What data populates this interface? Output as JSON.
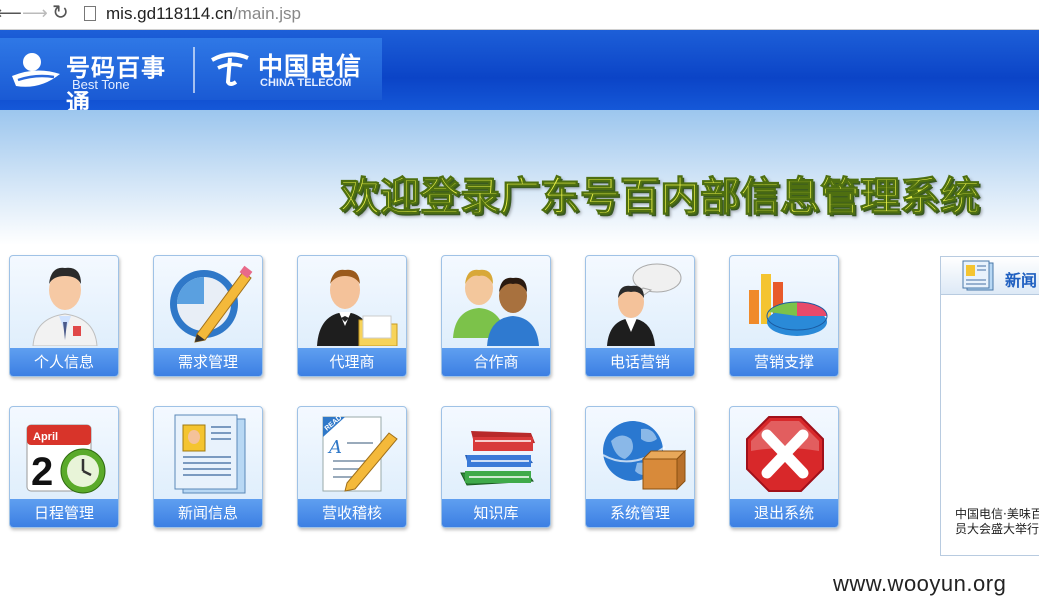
{
  "browser": {
    "url_host": "mis.gd118114.cn",
    "url_path": "/main.jsp",
    "icons": [
      "back-arrow-icon",
      "forward-arrow-icon",
      "reload-icon",
      "page-icon"
    ]
  },
  "header": {
    "logo1_cn": "号码百事通",
    "logo1_en": "Best Tone",
    "logo2_cn": "中国电信",
    "logo2_en": "CHINA TELECOM",
    "welcome": "欢迎登录广东号百内部信息管理系统"
  },
  "tiles_row1": [
    {
      "label": "个人信息",
      "icon": "person-icon"
    },
    {
      "label": "需求管理",
      "icon": "pencil-circle-icon"
    },
    {
      "label": "代理商",
      "icon": "agent-folder-icon"
    },
    {
      "label": "合作商",
      "icon": "partners-icon"
    },
    {
      "label": "电话营销",
      "icon": "speech-bubble-person-icon"
    },
    {
      "label": "营销支撑",
      "icon": "chart-pie-icon"
    }
  ],
  "tiles_row2": [
    {
      "label": "日程管理",
      "icon": "calendar-clock-icon"
    },
    {
      "label": "新闻信息",
      "icon": "newspaper-icon"
    },
    {
      "label": "营收稽核",
      "icon": "document-pen-icon"
    },
    {
      "label": "知识库",
      "icon": "books-icon"
    },
    {
      "label": "系统管理",
      "icon": "globe-box-icon"
    },
    {
      "label": "退出系统",
      "icon": "exit-x-icon"
    }
  ],
  "calendar": {
    "month": "April",
    "day": "2"
  },
  "read_badge": "READ",
  "side_panel": {
    "title": "新闻",
    "line1": "中国电信·美味百",
    "line2": "员大会盛大举行"
  },
  "watermark": "www.wooyun.org",
  "colors": {
    "header_blue": "#0b44c7",
    "tile_label_blue": "#3c7fe3",
    "welcome_yellow": "#ecf34a"
  }
}
